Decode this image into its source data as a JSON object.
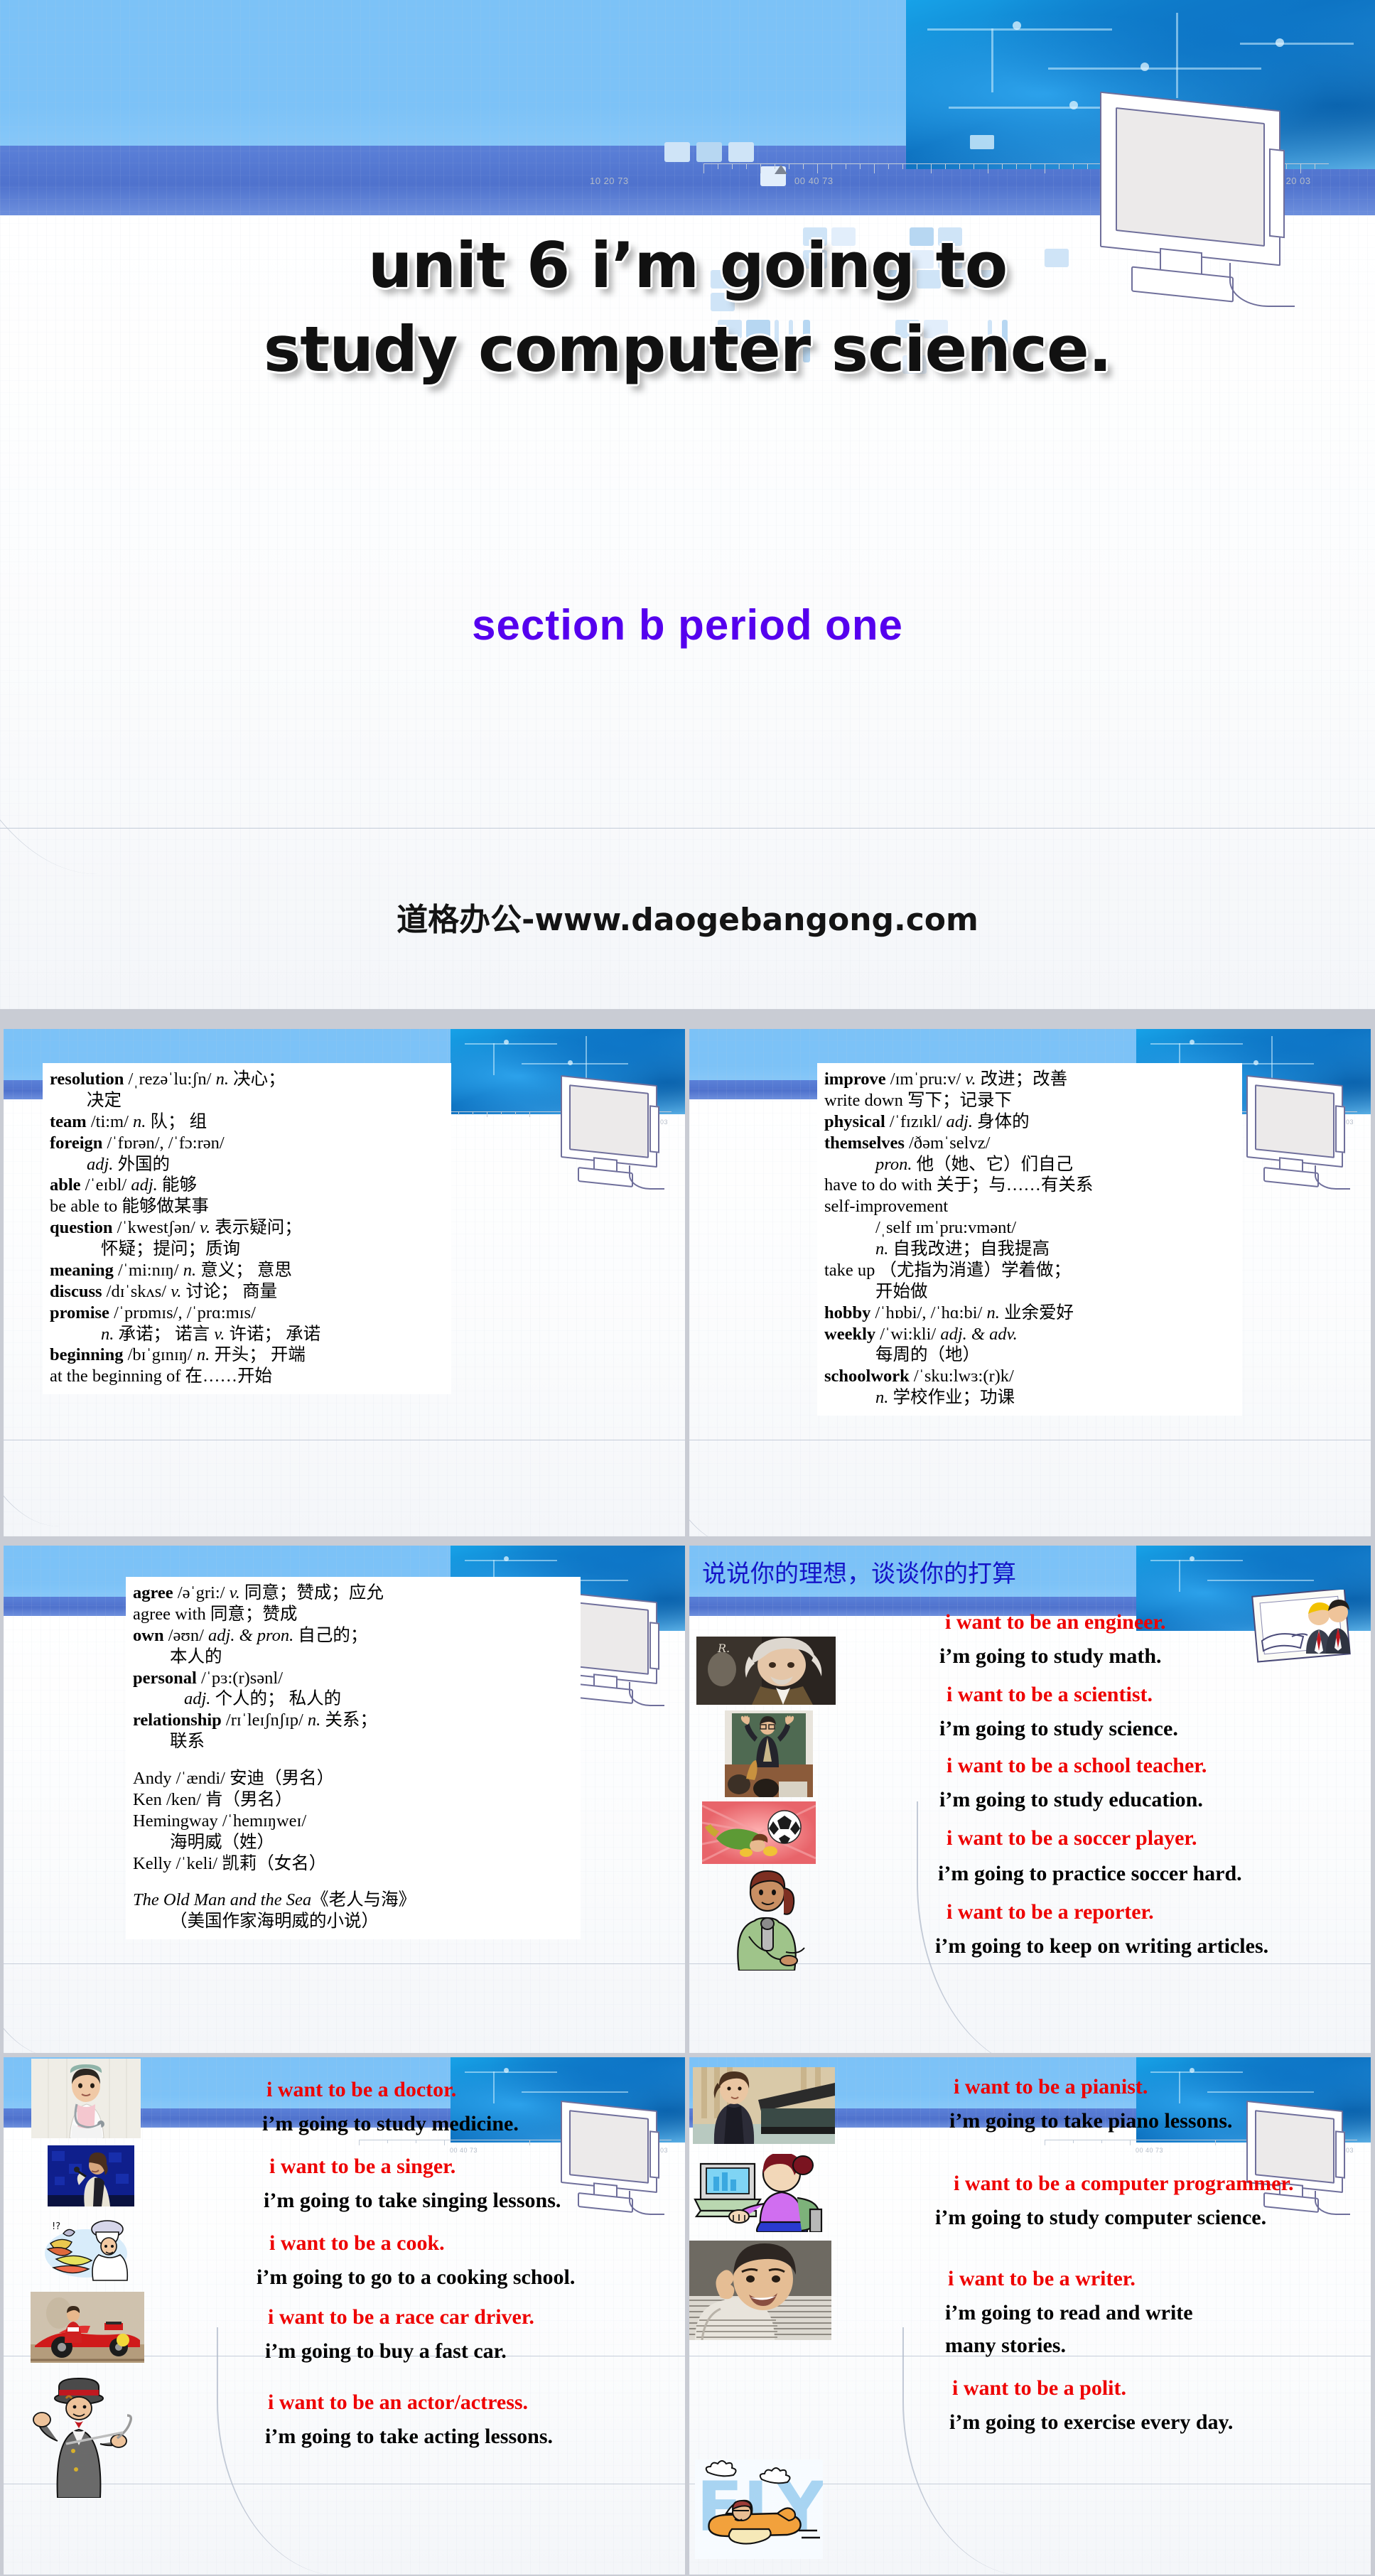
{
  "title_slide": {
    "title_line1": "unit 6  i’m going to",
    "title_line2": "study computer science.",
    "subtitle": "section b   period one",
    "watermark": "道格办公-www.daogebangong.com"
  },
  "vocab_panel_1": {
    "lines": [
      {
        "word": "resolution",
        "rest": " /ˌrezəˈlu:ʃn/ ",
        "pos": "n.",
        "cn": " 决心；"
      },
      {
        "indent": 1,
        "cn": "决定"
      },
      {
        "word": "team",
        "rest": " /ti:m/ ",
        "pos": "n.",
        "cn": " 队； 组"
      },
      {
        "word": "foreign",
        "rest": " /ˈfɒrən/, /ˈfɔ:rən/"
      },
      {
        "indent": 1,
        "pos": "adj.",
        "cn": " 外国的"
      },
      {
        "word": "able",
        "rest": " /ˈeɪbl/ ",
        "pos": "adj.",
        "cn": " 能够"
      },
      {
        "plain": "be able to",
        "cn": "  能够做某事"
      },
      {
        "word": "question",
        "rest": " /ˈkwestʃən/ ",
        "pos": "v.",
        "cn": " 表示疑问；"
      },
      {
        "indent": 2,
        "cn": "怀疑；提问；质询"
      },
      {
        "word": "meaning",
        "rest": " /ˈmi:nɪŋ/ ",
        "pos": "n.",
        "cn": " 意义； 意思"
      },
      {
        "word": "discuss",
        "rest": " /dɪˈskʌs/ ",
        "pos": "v.",
        "cn": " 讨论； 商量"
      },
      {
        "word": "promise",
        "rest": " /ˈprɒmɪs/, /ˈprɑ:mɪs/"
      },
      {
        "indent": 2,
        "pos": "n.",
        "cn": " 承诺； 诺言 ",
        "pos2": "v.",
        "cn2": " 许诺； 承诺"
      },
      {
        "word": "beginning",
        "rest": " /bɪˈgɪnɪŋ/ ",
        "pos": "n.",
        "cn": " 开头； 开端"
      },
      {
        "plain": "at the beginning of",
        "cn": " 在……开始"
      }
    ]
  },
  "vocab_panel_2": {
    "lines": [
      {
        "word": "improve",
        "rest": " /ɪmˈpru:v/ ",
        "pos": "v.",
        "cn": " 改进；改善"
      },
      {
        "plain": "write down",
        "cn": "  写下；记录下"
      },
      {
        "word": "physical",
        "rest": " /ˈfɪzɪkl/ ",
        "pos": "adj.",
        "cn": " 身体的"
      },
      {
        "word": "themselves",
        "rest": " /ðəmˈselvz/"
      },
      {
        "indent": 2,
        "pos": "pron.",
        "cn": " 他（她、它）们自己"
      },
      {
        "plain": "have to do with",
        "cn": " 关于；与……有关系"
      },
      {
        "plain": "self-improvement"
      },
      {
        "indent": 2,
        "rest": "/ˌself ɪmˈpru:vmənt/"
      },
      {
        "indent": 2,
        "pos": "n.",
        "cn": " 自我改进；自我提高"
      },
      {
        "plain": "take up",
        "cn": "（尤指为消遣）学着做；"
      },
      {
        "indent": 2,
        "cn": "开始做"
      },
      {
        "word": "hobby",
        "rest": " /ˈhɒbi/, /ˈhɑ:bi/ ",
        "pos": "n.",
        "cn": " 业余爱好"
      },
      {
        "word": "weekly",
        "rest": " /ˈwi:kli/ ",
        "pos": "adj. & adv."
      },
      {
        "indent": 2,
        "cn": "每周的（地）"
      },
      {
        "word": "schoolwork",
        "rest": " /ˈsku:lwɜ:(r)k/"
      },
      {
        "indent": 2,
        "pos": "n.",
        "cn": " 学校作业；功课"
      }
    ]
  },
  "vocab_panel_3": {
    "lines": [
      {
        "word": "agree",
        "rest": " /əˈgri:/ ",
        "pos": "v.",
        "cn": " 同意；赞成；应允"
      },
      {
        "plain": "agree with",
        "cn": "  同意；赞成"
      },
      {
        "word": "own",
        "rest": " /əʊn/ ",
        "pos": "adj. & pron.",
        "cn": " 自己的；"
      },
      {
        "indent": 1,
        "cn": "本人的"
      },
      {
        "word": "personal",
        "rest": " /ˈpɜ:(r)sənl/"
      },
      {
        "indent": 2,
        "pos": "adj.",
        "cn": " 个人的； 私人的"
      },
      {
        "word": "relationship",
        "rest": " /rɪˈleɪʃnʃɪp/ ",
        "pos": "n.",
        "cn": " 关系；"
      },
      {
        "indent": 1,
        "cn": "联系"
      },
      {
        "gap": true
      },
      {
        "plain": "Andy",
        "rest": " /ˈændi/ ",
        "cn": "安迪（男名）"
      },
      {
        "plain": "Ken",
        "rest": " /ken/ ",
        "cn": "肯（男名）"
      },
      {
        "plain": "Hemingway",
        "rest": " /ˈhemɪŋweɪ/"
      },
      {
        "indent": 1,
        "cn": "海明威（姓）"
      },
      {
        "plain": "Kelly",
        "rest": " /ˈkeli/ ",
        "cn": "凯莉（女名）"
      },
      {
        "gap": true
      },
      {
        "italic": "The Old Man and the Sea",
        "cn": "《老人与海》"
      },
      {
        "indent": 1,
        "cn": "（美国作家海明威的小说）"
      }
    ]
  },
  "ambition_panel_1": {
    "header": "说说你的理想，谈谈你的打算",
    "items": [
      {
        "q": "i want to be an engineer.",
        "a": [
          "i’m going to study math."
        ],
        "icon": "engineers-photo"
      },
      {
        "q": "i want to be a scientist.",
        "a": [
          "i’m going to study science."
        ],
        "icon": "einstein-photo"
      },
      {
        "q": "i want to be a school teacher.",
        "a": [
          "i’m going to study education."
        ],
        "icon": "teacher-photo"
      },
      {
        "q": "i want to be a soccer player.",
        "a": [
          "i’m going to practice soccer hard."
        ],
        "icon": "soccer-clipart"
      },
      {
        "q": "i want to be a reporter.",
        "a": [
          "i’m going to keep on writing articles."
        ],
        "icon": "reporter-clipart"
      }
    ]
  },
  "ambition_panel_2": {
    "items": [
      {
        "q": "i want to be a doctor.",
        "a": [
          "i’m going to study medicine."
        ],
        "icon": "doctor-photo"
      },
      {
        "q": "i want to be a singer.",
        "a": [
          "i’m going to take singing lessons."
        ],
        "icon": "singer-photo"
      },
      {
        "q": "i want to be a cook.",
        "a": [
          "i’m going to go to a cooking school."
        ],
        "icon": "cook-clipart"
      },
      {
        "q": "i want to be a race car driver.",
        "a": [
          "i’m going to buy a fast car."
        ],
        "icon": "racecar-photo"
      },
      {
        "q": "i want to be an actor/actress.",
        "a": [
          "i’m going to take acting lessons."
        ],
        "icon": "actor-clipart"
      }
    ]
  },
  "ambition_panel_3": {
    "items": [
      {
        "q": "i want to be a pianist.",
        "a": [
          "i’m going to take piano lessons."
        ],
        "icon": "pianist-photo"
      },
      {
        "q": "i want to be a computer programmer.",
        "a": [
          "i’m going to study computer science."
        ],
        "icon": "programmer-clipart"
      },
      {
        "q": "i want to be a writer.",
        "a": [
          "i’m going to read and write",
          "many stories."
        ],
        "icon": "writer-photo"
      },
      {
        "q": "i want to be a polit.",
        "a": [
          "i’m going to exercise every day."
        ],
        "icon": "plane-clipart"
      }
    ]
  },
  "decor": {
    "ruler_labels": [
      "10 20 73",
      "00 40 73",
      "00 20 03"
    ],
    "monitor_icon": "computer-monitor-lineart",
    "circuit_icon": "circuit-board-artwork"
  },
  "colors": {
    "band_light": "#7cc2f7",
    "band_dark": "#5278d2",
    "accent_red": "#ee0000",
    "accent_purple": "#5500ee",
    "header_blue": "#1414c8"
  }
}
